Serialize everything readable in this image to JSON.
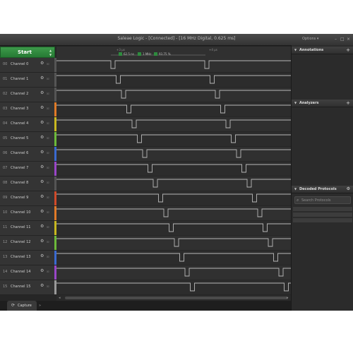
{
  "window": {
    "title": "Saleae Logic - [Connected] - [16 MHz Digital, 0.625 ms]",
    "options_label": "Options ▾",
    "min_glyph": "–",
    "max_glyph": "□",
    "close_glyph": "×"
  },
  "start_button": {
    "label": "Start",
    "up_glyph": "▲",
    "down_glyph": "▼"
  },
  "timeline": {
    "ticks": [
      "+3 μs",
      "+4 μs"
    ],
    "measurements": [
      "62.5 ns",
      "1 MHz",
      "93.75 %"
    ]
  },
  "channels": [
    {
      "num": "00",
      "name": "Channel 0",
      "color": "#555555"
    },
    {
      "num": "01",
      "name": "Channel 1",
      "color": "#555555"
    },
    {
      "num": "02",
      "name": "Channel 2",
      "color": "#555555"
    },
    {
      "num": "03",
      "name": "Channel 3",
      "color": "#e07a28"
    },
    {
      "num": "04",
      "name": "Channel 4",
      "color": "#c8b820"
    },
    {
      "num": "05",
      "name": "Channel 5",
      "color": "#6cba3a"
    },
    {
      "num": "06",
      "name": "Channel 6",
      "color": "#3a6ad0"
    },
    {
      "num": "07",
      "name": "Channel 7",
      "color": "#9a46c8"
    },
    {
      "num": "08",
      "name": "Channel 8",
      "color": "#555555"
    },
    {
      "num": "09",
      "name": "Channel 9",
      "color": "#d04a2a"
    },
    {
      "num": "10",
      "name": "Channel 10",
      "color": "#e07a28"
    },
    {
      "num": "11",
      "name": "Channel 11",
      "color": "#c8b820"
    },
    {
      "num": "12",
      "name": "Channel 12",
      "color": "#6cba3a"
    },
    {
      "num": "13",
      "name": "Channel 13",
      "color": "#3a6ad0"
    },
    {
      "num": "14",
      "name": "Channel 14",
      "color": "#9a46c8"
    },
    {
      "num": "15",
      "name": "Channel 15",
      "color": "#9a9a9a"
    }
  ],
  "channel_row": {
    "gear_glyph": "⚙",
    "trigger_label": "☒"
  },
  "bottom": {
    "capture_tab": "Capture",
    "capture_icon": "⟳",
    "add_tab": "»"
  },
  "panels": {
    "annotations": "Annotations",
    "analyzers": "Analyzers",
    "decoded": "Decoded Protocols",
    "collapse_glyph": "▼",
    "add_glyph": "+",
    "settings_glyph": "⚙",
    "search_icon": "⌕",
    "search_placeholder": "Search Protocols"
  },
  "scroll": {
    "left_glyph": "◂",
    "right_glyph": "▸"
  },
  "colors": {
    "accent_green": "#2e8b3e",
    "waveform": "#b8b8b8"
  }
}
